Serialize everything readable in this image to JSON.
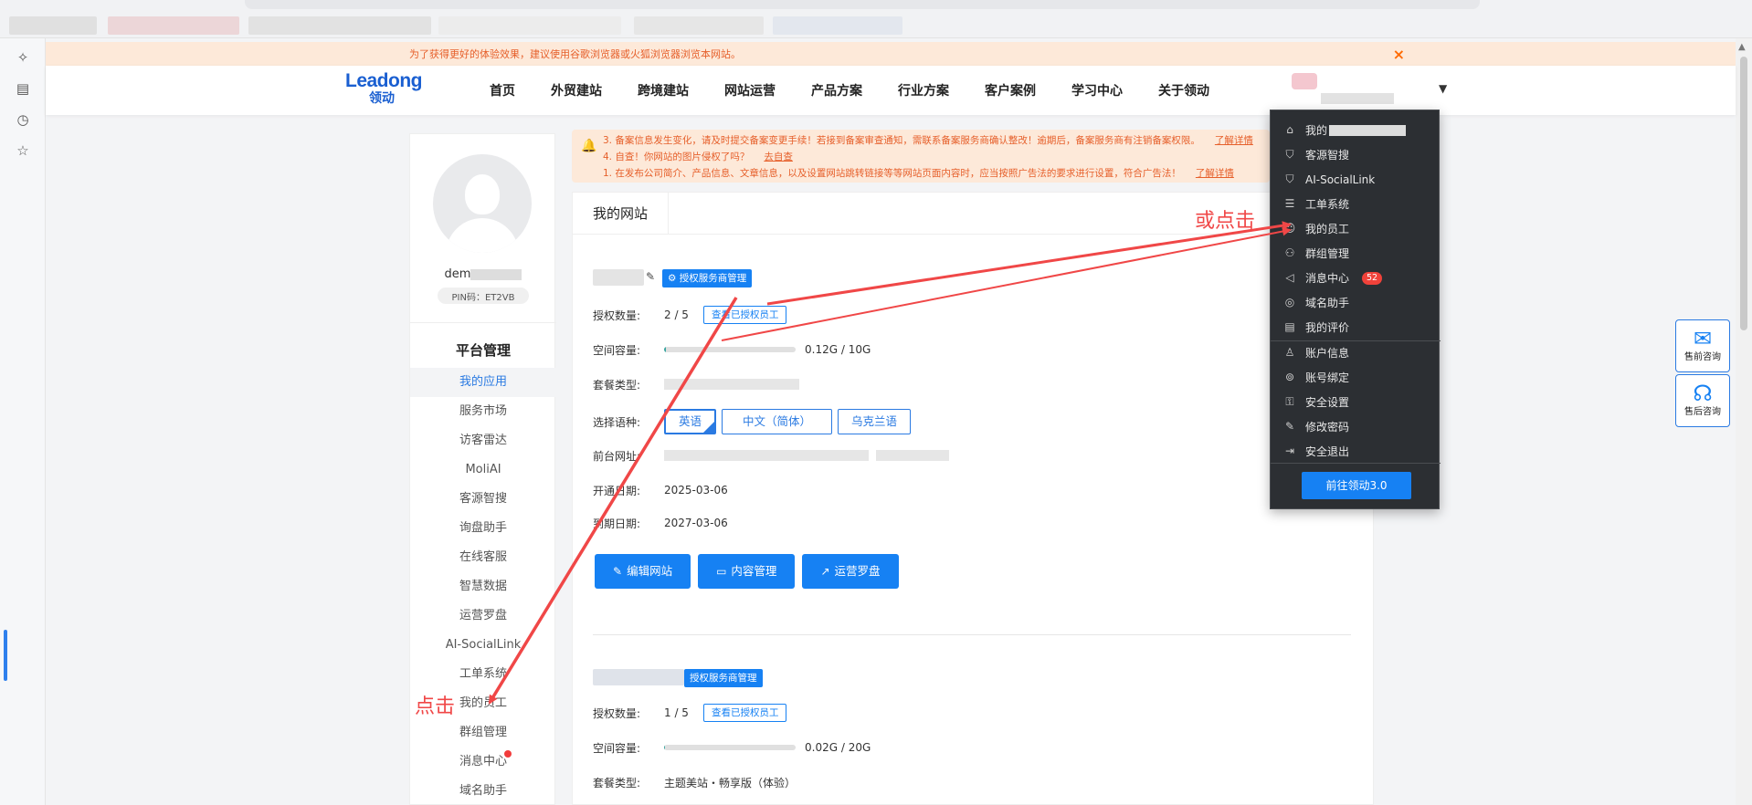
{
  "notice": {
    "text": "为了获得更好的体验效果，建议使用谷歌浏览器或火狐浏览器浏览本网站。",
    "close": "×"
  },
  "header": {
    "logo_en": "Leadong",
    "logo_cn": "领动",
    "nav": [
      "首页",
      "外贸建站",
      "跨境建站",
      "网站运营",
      "产品方案",
      "行业方案",
      "客户案例",
      "学习中心",
      "关于领动"
    ]
  },
  "profile": {
    "name_prefix": "dem",
    "pin": "PIN码：ET2VB"
  },
  "sidebar": {
    "title": "平台管理",
    "items": [
      "我的应用",
      "服务市场",
      "访客雷达",
      "MoliAI",
      "客源智搜",
      "询盘助手",
      "在线客服",
      "智慧数据",
      "运营罗盘",
      "AI-SocialLink",
      "工单系统",
      "我的员工",
      "群组管理",
      "消息中心",
      "域名助手"
    ]
  },
  "alert": {
    "line1": "3. 备案信息发生变化，请及时提交备案变更手续！若接到备案审查通知，需联系备案服务商确认整改！逾期后，备案服务商有注销备案权限。",
    "line1_link": "了解详情",
    "line2": "4. 自查！你网站的图片侵权了吗？",
    "line2_link": "去自查",
    "line3": "1. 在发布公司简介、产品信息、文章信息，以及设置网站跳转链接等等网站页面内容时，应当按照广告法的要求进行设置，符合广告法！",
    "line3_link": "了解详情"
  },
  "main": {
    "tab": "我的网站",
    "auth_button": "授权服务商管理",
    "view_staff_button": "查看已授权员工",
    "labels": {
      "auth_count": "授权数量:",
      "space": "空间容量:",
      "plan": "套餐类型:",
      "language": "选择语种:",
      "front_url": "前台网址:",
      "open_date": "开通日期:",
      "expire_date": "到期日期:"
    },
    "site1": {
      "auth_count": "2 / 5",
      "space": "0.12G / 10G",
      "space_fraction": 0.012,
      "languages": [
        "英语",
        "中文（简体）",
        "乌克兰语"
      ],
      "selected_language": "英语",
      "open_date": "2025-03-06",
      "expire_date": "2027-03-06",
      "actions": [
        "编辑网站",
        "内容管理",
        "运营罗盘"
      ]
    },
    "site2": {
      "auth_count": "1 / 5",
      "space": "0.02G / 20G",
      "space_fraction": 0.001,
      "plan": "主题美站・畅享版（体验）"
    }
  },
  "dropdown": {
    "items": [
      {
        "icon": "home-icon",
        "label": "我的"
      },
      {
        "icon": "search-user-icon",
        "label": "客源智搜"
      },
      {
        "icon": "link-icon",
        "label": "AI-SocialLink"
      },
      {
        "icon": "clipboard-icon",
        "label": "工单系统"
      },
      {
        "icon": "staff-icon",
        "label": "我的员工"
      },
      {
        "icon": "group-icon",
        "label": "群组管理"
      },
      {
        "icon": "speaker-icon",
        "label": "消息中心",
        "badge": "52"
      },
      {
        "icon": "www-icon",
        "label": "域名助手"
      },
      {
        "icon": "review-icon",
        "label": "我的评价"
      },
      {
        "icon": "user-icon",
        "label": "账户信息"
      },
      {
        "icon": "bind-icon",
        "label": "账号绑定"
      },
      {
        "icon": "lock-icon",
        "label": "安全设置"
      },
      {
        "icon": "edit-password-icon",
        "label": "修改密码"
      },
      {
        "icon": "logout-icon",
        "label": "安全退出"
      }
    ],
    "go_button": "前往领动3.0"
  },
  "consult": {
    "pre_sale": "售前咨询",
    "after_sale": "售后咨询"
  },
  "annotations": {
    "click": "点击",
    "or_click": "或点击",
    "color": "#f04747"
  },
  "colors": {
    "primary": "#1681f3",
    "accent_orange": "#e65f2a",
    "dropdown_bg": "#2c2f33"
  }
}
